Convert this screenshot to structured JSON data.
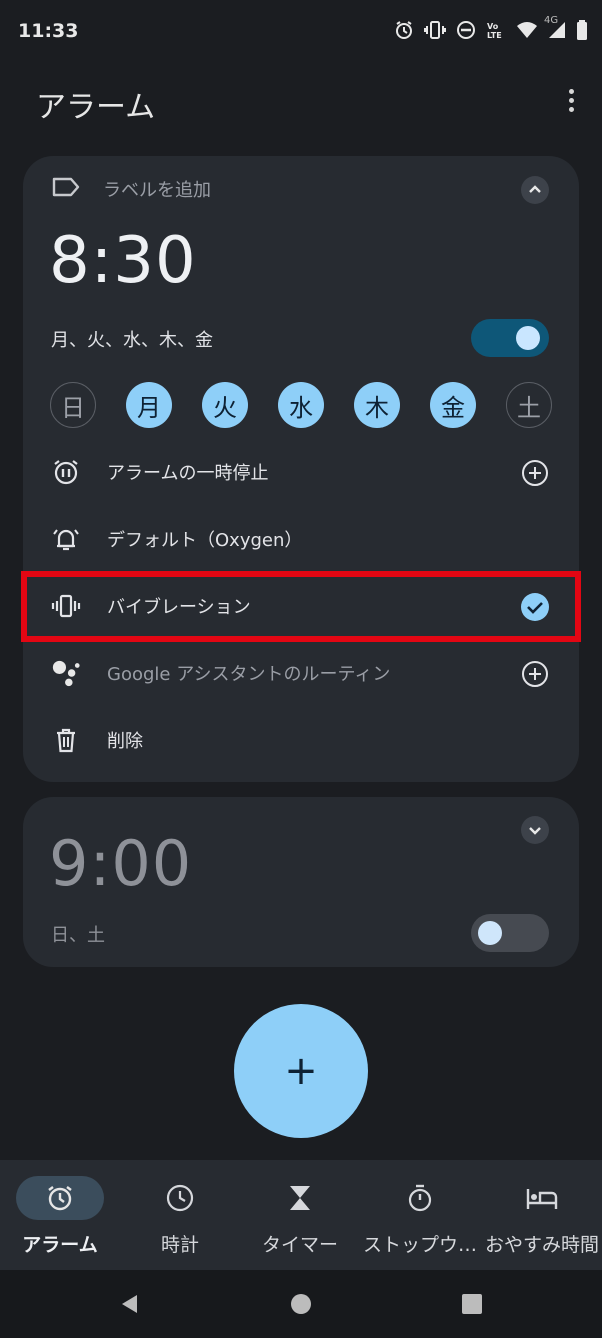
{
  "status_bar": {
    "time": "11:33",
    "icons": [
      "alarm-icon",
      "vibrate-icon",
      "dnd-icon",
      "volte-icon",
      "wifi-icon",
      "signal-4g-icon",
      "battery-icon"
    ],
    "network": "4G"
  },
  "header": {
    "title": "アラーム"
  },
  "alarm1": {
    "label_placeholder": "ラベルを追加",
    "time": "8:30",
    "days_summary": "月、火、水、木、金",
    "enabled": true,
    "weekdays": [
      {
        "label": "日",
        "selected": false
      },
      {
        "label": "月",
        "selected": true
      },
      {
        "label": "火",
        "selected": true
      },
      {
        "label": "水",
        "selected": true
      },
      {
        "label": "木",
        "selected": true
      },
      {
        "label": "金",
        "selected": true
      },
      {
        "label": "土",
        "selected": false
      }
    ],
    "options": {
      "pause": "アラームの一時停止",
      "sound": "デフォルト（Oxygen）",
      "vibration": "バイブレーション",
      "vibration_checked": true,
      "assistant": "Google アシスタントのルーティン",
      "delete": "削除"
    }
  },
  "alarm2": {
    "time": "9:00",
    "days_summary": "日、土",
    "enabled": false
  },
  "fab": {
    "label": "+"
  },
  "bottom_nav": [
    {
      "label": "アラーム",
      "icon": "alarm-icon",
      "active": true
    },
    {
      "label": "時計",
      "icon": "clock-icon",
      "active": false
    },
    {
      "label": "タイマー",
      "icon": "hourglass-icon",
      "active": false
    },
    {
      "label": "ストップウ…",
      "icon": "stopwatch-icon",
      "active": false
    },
    {
      "label": "おやすみ時間",
      "icon": "bed-icon",
      "active": false
    }
  ],
  "colors": {
    "background": "#1b1d21",
    "card": "#272b31",
    "accent": "#8ecff8",
    "toggle_on": "#0e5778",
    "highlight": "#e30613"
  }
}
